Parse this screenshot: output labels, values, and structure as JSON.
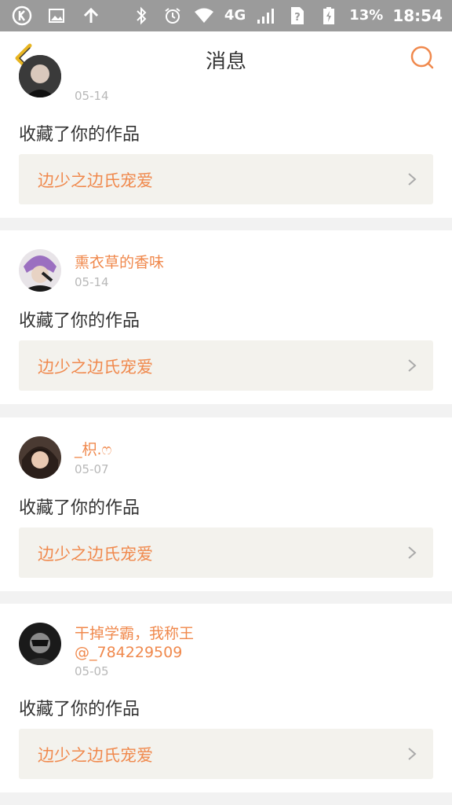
{
  "status_bar": {
    "icons_left": [
      "k-icon",
      "image-icon",
      "upload-arrow-icon"
    ],
    "icons_right": [
      "bluetooth-icon",
      "alarm-icon",
      "wifi-icon",
      "signal-icon",
      "sim-icon",
      "battery-icon"
    ],
    "network": "4G",
    "battery": "13%",
    "time": "18:54"
  },
  "header": {
    "title": "消息"
  },
  "feed": {
    "items": [
      {
        "username": "",
        "handle": "",
        "date": "05-14",
        "action": "收藏了你的作品",
        "work_title": "边少之边氏宠爱"
      },
      {
        "username": "熏衣草的香味",
        "handle": "",
        "date": "05-14",
        "action": "收藏了你的作品",
        "work_title": "边少之边氏宠爱"
      },
      {
        "username": "_枳.ෆ",
        "handle": "",
        "date": "05-07",
        "action": "收藏了你的作品",
        "work_title": "边少之边氏宠爱"
      },
      {
        "username": "干掉学霸，我称王",
        "handle": "@_784229509",
        "date": "05-05",
        "action": "收藏了你的作品",
        "work_title": "边少之边氏宠爱"
      }
    ]
  },
  "colors": {
    "accent": "#f0894d",
    "back_arrow": "#e8b522",
    "status_bar": "#9b9b9b"
  }
}
